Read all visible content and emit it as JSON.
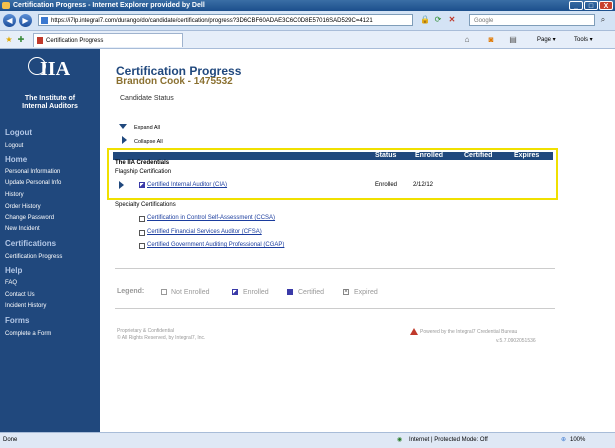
{
  "window": {
    "title": "Certification Progress - Internet Explorer provided by Dell",
    "buttons": [
      "_",
      "□",
      "X"
    ]
  },
  "toolbar": {
    "back": "◀",
    "forward": "▶",
    "url": "https://i7lp.integral7.com/durango/do/candidate/certification/progress?3D6CBF60ADAE3C6C0D8E57016SAD529C=4121",
    "search_placeholder": "Google",
    "search_icon": "search-icon"
  },
  "tabs": {
    "active": "Certification Progress",
    "right_tools": [
      "Page ▾",
      "Tools ▾"
    ]
  },
  "sidebar": {
    "logo_mark": "IIA",
    "logo_line1": "The Institute of",
    "logo_line2": "Internal Auditors",
    "sections": [
      {
        "title": "Logout",
        "items": [
          "Logout"
        ]
      },
      {
        "title": "Home",
        "items": [
          "Personal Information",
          "Update Personal Info",
          "History",
          "Order History",
          "Change Password",
          "New Incident"
        ]
      },
      {
        "title": "Certifications",
        "items": [
          "Certification Progress"
        ]
      },
      {
        "title": "Help",
        "items": [
          "FAQ",
          "Contact Us",
          "Incident History"
        ]
      },
      {
        "title": "Forms",
        "items": [
          "Complete a Form"
        ]
      }
    ]
  },
  "main": {
    "title": "Certification Progress",
    "candidate": "Brandon Cook - 1475532",
    "status_label": "Candidate Status",
    "expand_all": "Expand All",
    "collapse_all": "Collapse All",
    "table": {
      "section_title": "The IIA Credentials",
      "columns": [
        "Status",
        "Enrolled",
        "Certified",
        "Expires"
      ],
      "flagship_label": "Flagship Certification",
      "flagship": [
        {
          "name": "Certified Internal Auditor (CIA)",
          "status": "Enrolled",
          "enrolled": "2/12/12",
          "certified": "",
          "expires": ""
        }
      ],
      "specialty_label": "Specialty Certifications",
      "specialty": [
        {
          "name": "Certification in Control Self-Assessment (CCSA)"
        },
        {
          "name": "Certified Financial Services Auditor (CFSA)"
        },
        {
          "name": "Certified Government Auditing Professional (CGAP)"
        }
      ]
    },
    "legend": {
      "label": "Legend:",
      "items": [
        "Not Enrolled",
        "Enrolled",
        "Certified",
        "Expired"
      ]
    },
    "footer": {
      "left1": "Proprietary & Confidential",
      "left2": "© All Rights Reserved, by Integral7, Inc.",
      "right1": "Powered by the Integral7 Credential Bureau",
      "right2": "v.5.7.0902051536"
    }
  },
  "statusbar": {
    "left": "Done",
    "zone": "Internet | Protected Mode: Off",
    "zoom": "100%"
  }
}
